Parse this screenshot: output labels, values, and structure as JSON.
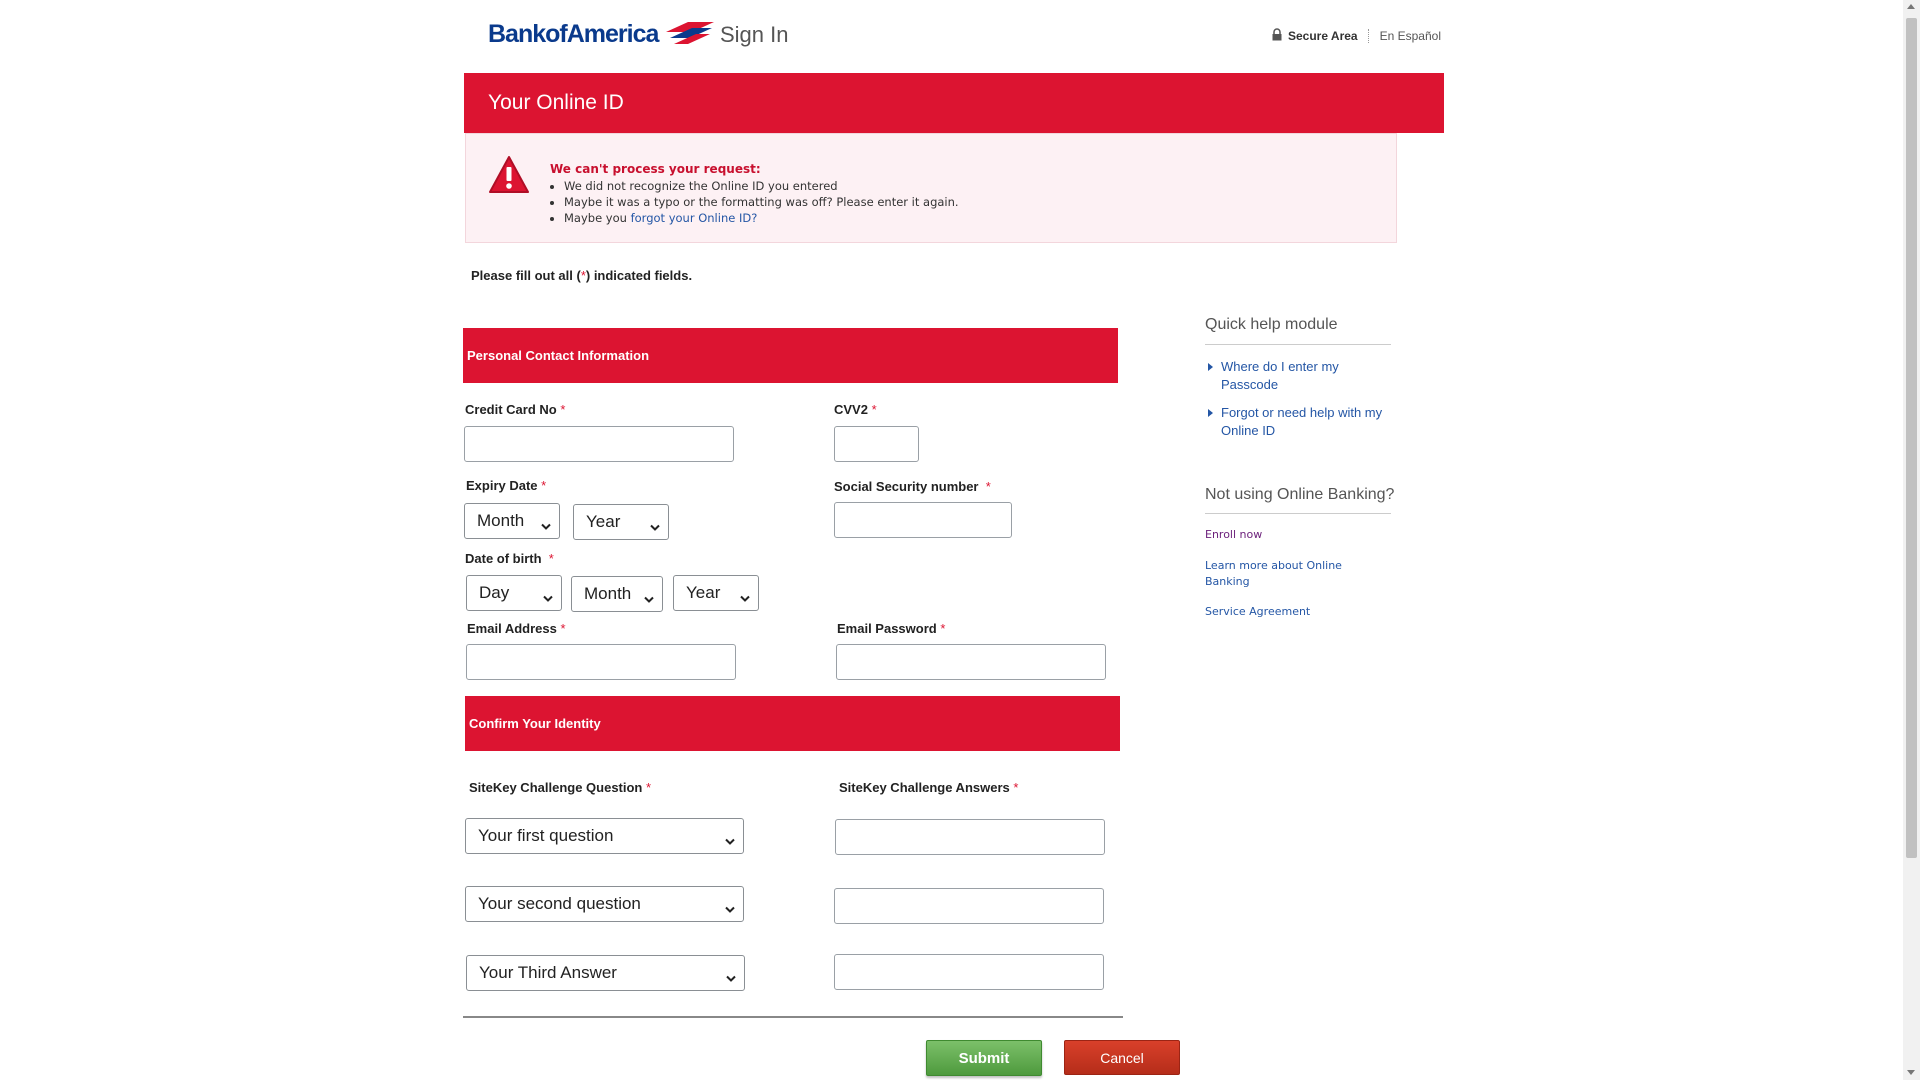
{
  "header": {
    "logo_text": "BankofAmerica",
    "signin": "Sign In",
    "secure_area": "Secure Area",
    "spanish": "En Español"
  },
  "banner": {
    "title": "Your Online ID"
  },
  "error": {
    "title": "We can't process your request:",
    "item1": "We did not recognize the Online ID you entered",
    "item2": "Maybe it was a typo or the formatting was off? Please enter it again.",
    "item3_prefix": "Maybe you ",
    "item3_link": "forgot your Online ID?"
  },
  "form": {
    "fill_note_prefix": "Please fill out all (",
    "fill_note_req": "*",
    "fill_note_suffix": ") indicated fields.",
    "required_mark": "*",
    "section1": "Personal Contact Information",
    "credit_card_label": "Credit Card No",
    "cvv_label": "CVV2",
    "expiry_label": "Expiry Date",
    "ssn_label": "Social Security number",
    "dob_label": "Date of birth",
    "email_label": "Email Address",
    "email_password_label": "Email Password",
    "expiry_month": "Month",
    "expiry_year": "Year",
    "dob_day": "Day",
    "dob_month": "Month",
    "dob_year": "Year",
    "section2": "Confirm Your Identity",
    "sitekey_q_label": "SiteKey Challenge Question",
    "sitekey_a_label": "SiteKey Challenge Answers",
    "question1": "Your first question",
    "question2": "Your second question",
    "question3": "Your Third Answer",
    "submit": "Submit",
    "cancel": "Cancel"
  },
  "sidebar": {
    "quick_help_title": "Quick help module",
    "help1": "Where do I enter my Passcode",
    "help2": "Forgot or need help with my Online ID",
    "not_using_title": "Not using Online Banking?",
    "enroll": "Enroll now",
    "learn_more": "Learn more about Online Banking",
    "service_agreement": "Service Agreement"
  },
  "colors": {
    "brand_red": "#dc1431",
    "brand_blue": "#0a3a8c",
    "link_blue": "#2456a5"
  }
}
